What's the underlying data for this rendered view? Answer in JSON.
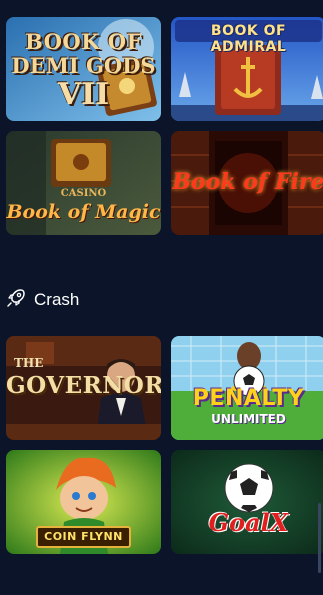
{
  "top_games": [
    {
      "id": "book-of-demi-gods-vii",
      "lines": [
        "BOOK OF",
        "DEMI GODS",
        "VII"
      ]
    },
    {
      "id": "book-of-admiral",
      "lines": [
        "BOOK OF ADMIRAL"
      ]
    },
    {
      "id": "book-of-magic",
      "lines": [
        "CASINO",
        "Book of Magic"
      ]
    },
    {
      "id": "book-of-fire",
      "lines": [
        "Book of Fire"
      ]
    }
  ],
  "section": {
    "label": "Crash",
    "icon": "rocket-icon"
  },
  "crash_games": [
    {
      "id": "the-governor",
      "lines": [
        "THE",
        "GOVERNOR"
      ]
    },
    {
      "id": "penalty-unlimited",
      "lines": [
        "PENALTY",
        "UNLIMITED"
      ]
    },
    {
      "id": "coin-flynn",
      "lines": [
        "COIN FLYNN"
      ]
    },
    {
      "id": "goalx",
      "lines": [
        "GoalX"
      ]
    }
  ],
  "colors": {
    "background": "#0b1428",
    "text": "#ffffff"
  }
}
